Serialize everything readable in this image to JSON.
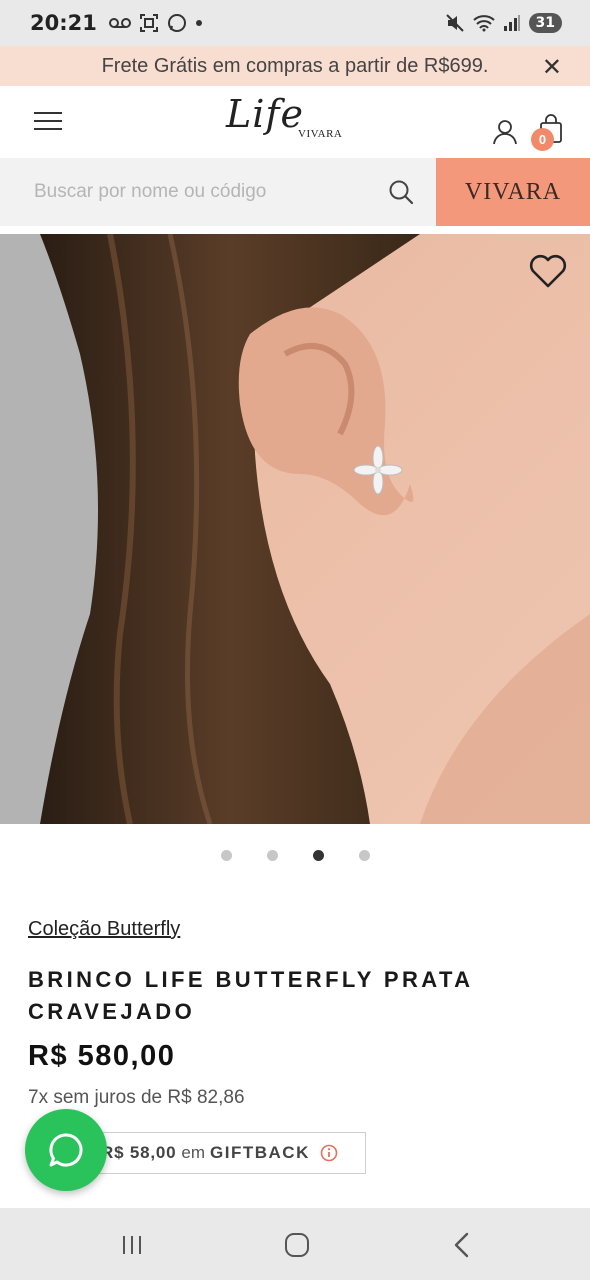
{
  "status_bar": {
    "time": "20:21",
    "battery": "31",
    "icons": [
      "voicemail-icon",
      "screenshot-icon",
      "whatsapp-icon",
      "dot-icon",
      "mute-icon",
      "wifi-icon",
      "signal-icon",
      "battery-icon"
    ]
  },
  "promo": {
    "text": "Frete Grátis em compras a partir de R$699.",
    "close_icon": "close-icon"
  },
  "header": {
    "logo_script": "Life",
    "logo_sub": "VIVARA",
    "cart_count": "0",
    "icons": [
      "hamburger-menu-icon",
      "user-icon",
      "shopping-bag-icon"
    ]
  },
  "search": {
    "placeholder": "Buscar por nome ou código",
    "value": "",
    "brand_button": "VIVARA"
  },
  "gallery": {
    "image_description_icon": "product-photo",
    "dots_count": 4,
    "active_dot": 2
  },
  "product": {
    "collection": "Coleção Butterfly",
    "title": "BRINCO LIFE BUTTERFLY PRATA CRAVEJADO",
    "price": "R$ 580,00",
    "installments": "7x sem juros de R$ 82,86",
    "giftback_amount": "R$ 58,00",
    "giftback_mid": "em",
    "giftback_label": "GIFTBACK"
  },
  "colors": {
    "promo_bg": "#f8ddd1",
    "accent": "#f4987c",
    "badge": "#f08a6a",
    "whatsapp": "#29c25b",
    "system_bar": "#e9e9e9"
  }
}
